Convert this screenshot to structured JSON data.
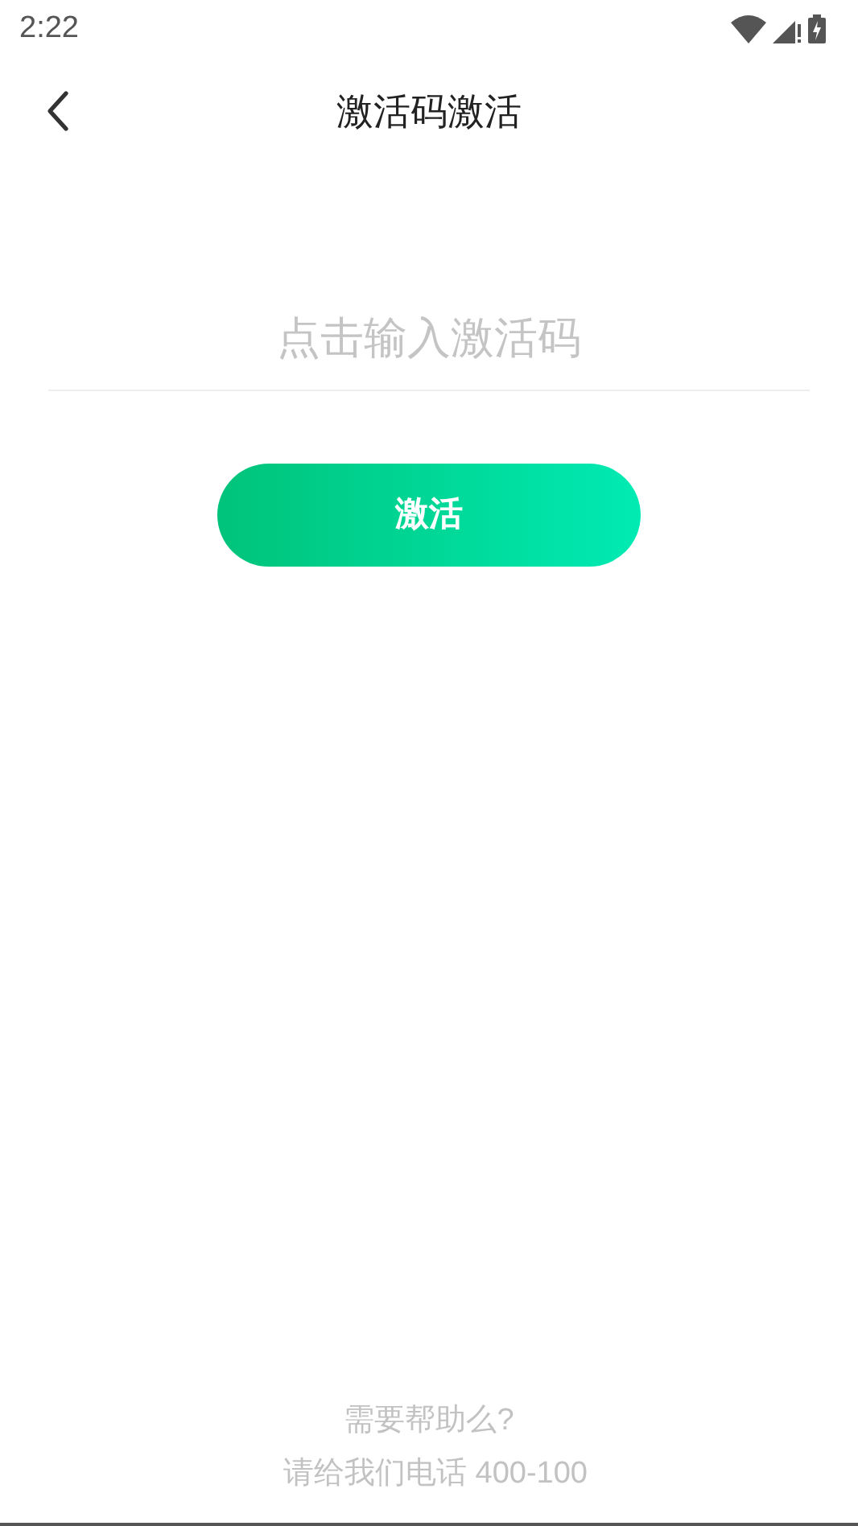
{
  "status_bar": {
    "time": "2:22"
  },
  "header": {
    "title": "激活码激活"
  },
  "code_field": {
    "placeholder": "点击输入激活码"
  },
  "activate_button": {
    "label": "激活"
  },
  "help": {
    "question": "需要帮助么?",
    "contact": "请给我们电话 400-100"
  }
}
